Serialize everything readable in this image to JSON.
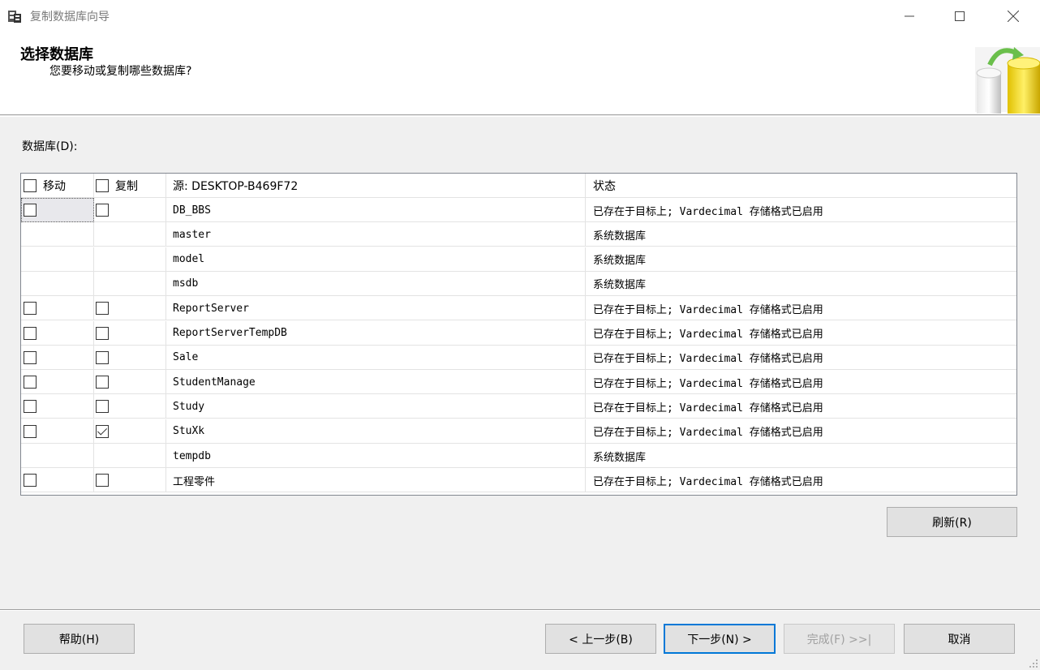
{
  "window": {
    "title": "复制数据库向导",
    "controls": {
      "minimize": "—",
      "maximize": "☐",
      "close": "✕"
    }
  },
  "header": {
    "title": "选择数据库",
    "subtitle": "您要移动或复制哪些数据库?"
  },
  "databases_label": "数据库(D):",
  "grid": {
    "columns": {
      "move": "移动",
      "copy": "复制",
      "source": "源: DESKTOP-B469F72",
      "status": "状态"
    },
    "rows": [
      {
        "name": "DB_BBS",
        "status": "已存在于目标上; Vardecimal 存储格式已启用",
        "has_checkboxes": true,
        "move": false,
        "copy": false
      },
      {
        "name": "master",
        "status": "系统数据库",
        "has_checkboxes": false
      },
      {
        "name": "model",
        "status": "系统数据库",
        "has_checkboxes": false
      },
      {
        "name": "msdb",
        "status": "系统数据库",
        "has_checkboxes": false
      },
      {
        "name": "ReportServer",
        "status": "已存在于目标上; Vardecimal 存储格式已启用",
        "has_checkboxes": true,
        "move": false,
        "copy": false
      },
      {
        "name": "ReportServerTempDB",
        "status": "已存在于目标上; Vardecimal 存储格式已启用",
        "has_checkboxes": true,
        "move": false,
        "copy": false
      },
      {
        "name": "Sale",
        "status": "已存在于目标上; Vardecimal 存储格式已启用",
        "has_checkboxes": true,
        "move": false,
        "copy": false
      },
      {
        "name": "StudentManage",
        "status": "已存在于目标上; Vardecimal 存储格式已启用",
        "has_checkboxes": true,
        "move": false,
        "copy": false
      },
      {
        "name": "Study",
        "status": "已存在于目标上; Vardecimal 存储格式已启用",
        "has_checkboxes": true,
        "move": false,
        "copy": false
      },
      {
        "name": "StuXk",
        "status": "已存在于目标上; Vardecimal 存储格式已启用",
        "has_checkboxes": true,
        "move": false,
        "copy": true
      },
      {
        "name": "tempdb",
        "status": "系统数据库",
        "has_checkboxes": false
      },
      {
        "name": "工程零件",
        "status": "已存在于目标上; Vardecimal 存储格式已启用",
        "has_checkboxes": true,
        "move": false,
        "copy": false
      }
    ]
  },
  "buttons": {
    "refresh": "刷新(R)",
    "help": "帮助(H)",
    "back": "< 上一步(B)",
    "next": "下一步(N) >",
    "finish": "完成(F) >>|",
    "cancel": "取消"
  },
  "colors": {
    "focus_border": "#0078d7",
    "disabled_text": "#a0a0a0"
  }
}
